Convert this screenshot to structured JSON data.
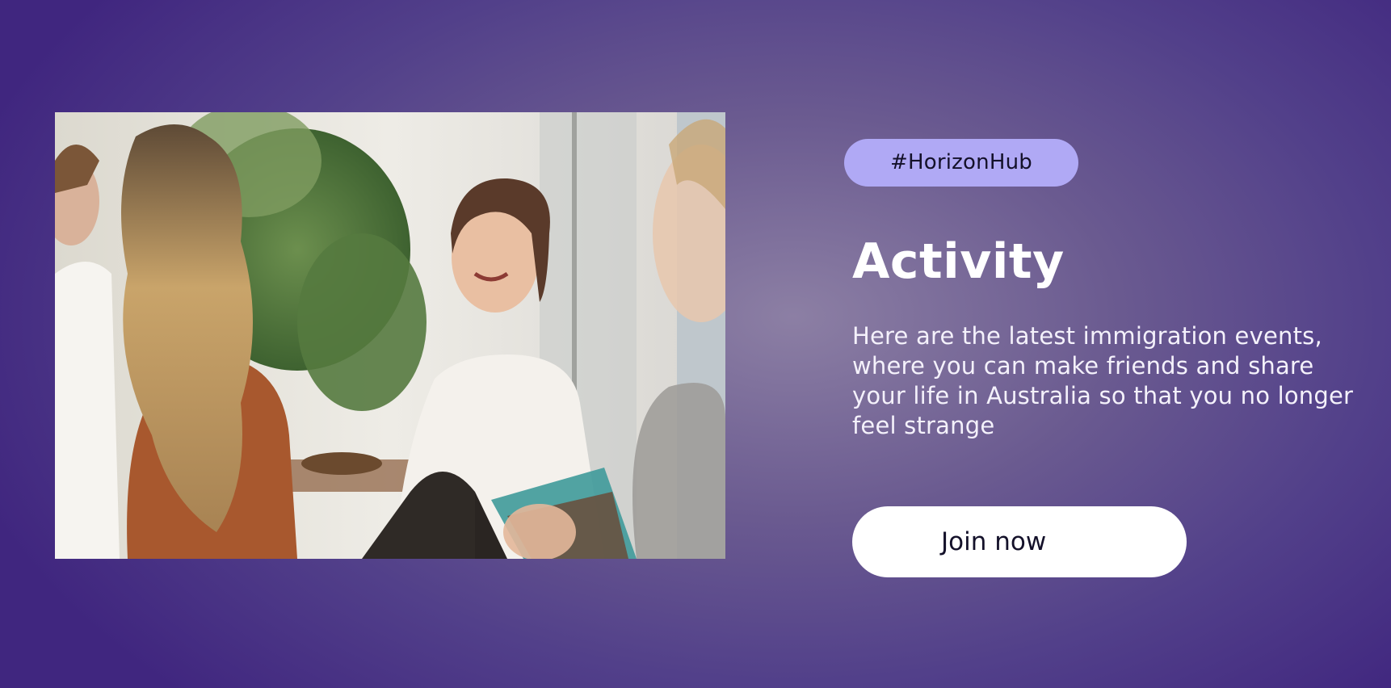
{
  "photo": {
    "alt": "",
    "palette": {
      "background": "#e8e4dc",
      "foliage": "#4f7a3c",
      "blouse": "#f4f1ec",
      "hair_dark": "#5a3a2a",
      "hair_blonde": "#c9a46a",
      "jacket": "#a8582e"
    }
  },
  "tag": {
    "label": "#HorizonHub"
  },
  "heading": {
    "title": "Activity"
  },
  "description": {
    "text": "Here are the latest immigration events, where you can make friends and share your life in Australia so that you no longer feel strange"
  },
  "cta": {
    "label": "Join now"
  },
  "colors": {
    "tag_bg": "#b0a9f5",
    "button_bg": "#ffffff",
    "bg_center": "#8c7fa4",
    "bg_edge": "#40267f"
  }
}
